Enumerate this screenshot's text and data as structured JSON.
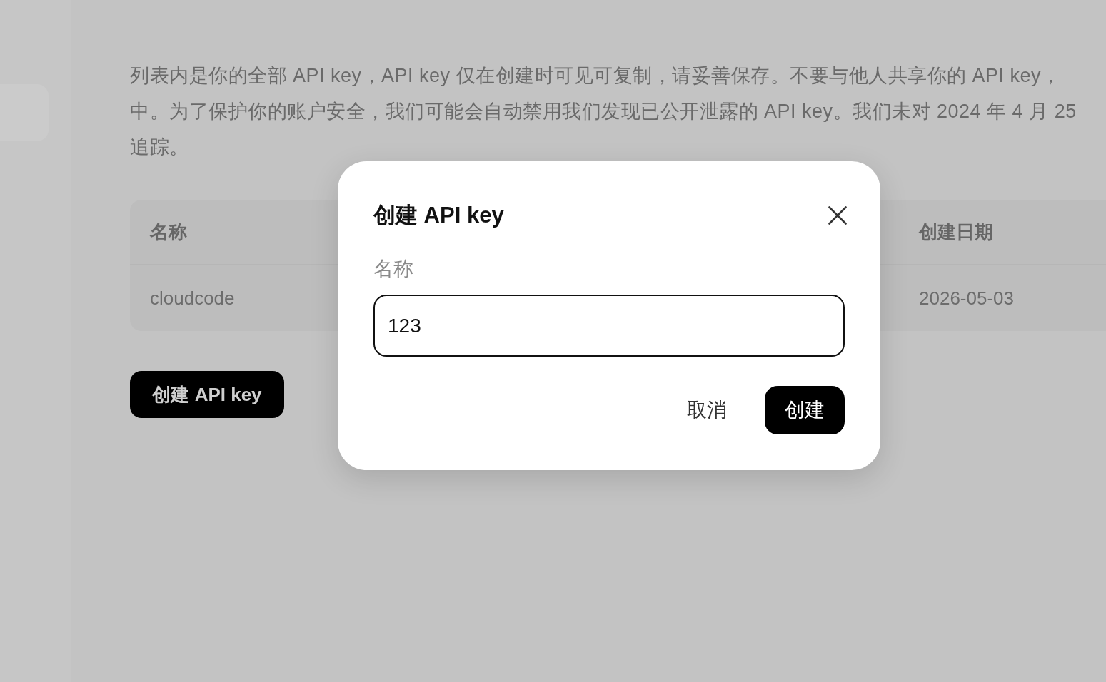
{
  "sidebar": {
    "items": [
      {
        "selected": true
      }
    ]
  },
  "page": {
    "intro_lines": [
      "列表内是你的全部 API key，API key 仅在创建时可见可复制，请妥善保存。不要与他人共享你的 API key，",
      "中。为了保护你的账户安全，我们可能会自动禁用我们发现已公开泄露的 API key。我们未对 2024 年 4 月 25",
      "追踪。"
    ],
    "table": {
      "columns": [
        {
          "label": "名称"
        },
        {
          "label": "创建日期"
        }
      ],
      "rows": [
        [
          "cloudcode",
          "2026-05-03"
        ]
      ]
    },
    "create_button": "创建 API key"
  },
  "dialog": {
    "title": "创建 API key",
    "field_label": "名称",
    "field_value": "123",
    "buttons": [
      {
        "label": "取消",
        "kind": "secondary"
      },
      {
        "label": "创建",
        "kind": "primary"
      }
    ]
  }
}
